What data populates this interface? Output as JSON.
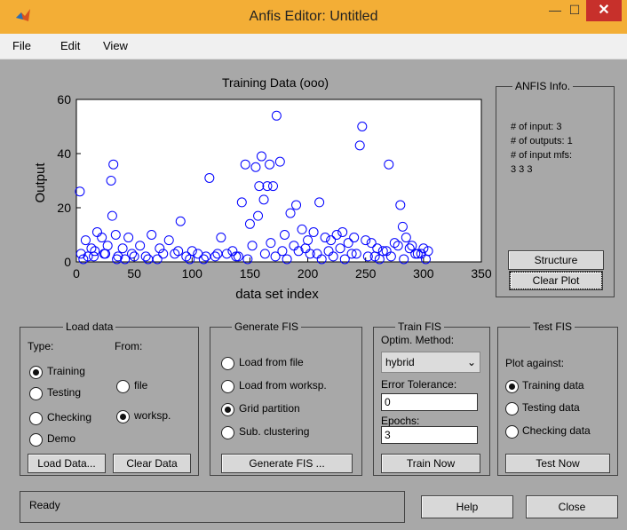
{
  "window": {
    "title": "Anfis Editor: Untitled",
    "controls": {
      "minimize": "—",
      "maximize": "☐",
      "close": "✕"
    }
  },
  "menu": [
    "File",
    "Edit",
    "View"
  ],
  "chart_data": {
    "type": "scatter",
    "title": "Training Data (ooo)",
    "xlabel": "data set index",
    "ylabel": "Output",
    "xlim": [
      0,
      350
    ],
    "ylim": [
      0,
      60
    ],
    "xticks": [
      "0",
      "50",
      "100",
      "150",
      "200",
      "250",
      "300",
      "350"
    ],
    "yticks": [
      "0",
      "20",
      "40",
      "60"
    ],
    "marker": "circle-open",
    "color": "#0000ff",
    "x": [
      3,
      8,
      13,
      18,
      22,
      27,
      30,
      31,
      32,
      34,
      40,
      45,
      55,
      65,
      72,
      80,
      90,
      105,
      115,
      125,
      135,
      143,
      146,
      150,
      155,
      157,
      158,
      160,
      162,
      165,
      167,
      170,
      173,
      176,
      180,
      185,
      190,
      195,
      200,
      205,
      210,
      215,
      220,
      225,
      230,
      235,
      240,
      245,
      247,
      250,
      255,
      260,
      265,
      270,
      275,
      280,
      282,
      285,
      290,
      295,
      300,
      304,
      4,
      10,
      16,
      24,
      36,
      42,
      48,
      60,
      70,
      85,
      95,
      100,
      110,
      120,
      130,
      140,
      152,
      168,
      178,
      188,
      198,
      208,
      218,
      228,
      238,
      258,
      268,
      278,
      288,
      298,
      6,
      15,
      25,
      35,
      50,
      62,
      75,
      88,
      98,
      112,
      122,
      138,
      148,
      163,
      172,
      182,
      192,
      202,
      212,
      222,
      232,
      242,
      252,
      262,
      272,
      283,
      293,
      302
    ],
    "y": [
      26,
      8,
      5,
      11,
      9,
      6,
      30,
      17,
      36,
      10,
      5,
      9,
      6,
      10,
      5,
      8,
      15,
      3,
      31,
      9,
      4,
      22,
      36,
      14,
      35,
      17,
      28,
      39,
      23,
      28,
      36,
      28,
      54,
      37,
      10,
      18,
      21,
      12,
      8,
      11,
      22,
      9,
      8,
      10,
      11,
      7,
      9,
      43,
      50,
      8,
      7,
      5,
      4,
      36,
      7,
      21,
      13,
      9,
      6,
      3,
      5,
      4,
      3,
      2,
      4,
      3,
      2,
      1,
      3,
      2,
      1,
      3,
      2,
      4,
      1,
      2,
      3,
      2,
      6,
      7,
      4,
      6,
      5,
      3,
      4,
      5,
      3,
      2,
      4,
      6,
      5,
      3,
      1,
      2,
      3,
      1,
      2,
      1,
      3,
      4,
      1,
      2,
      3,
      2,
      1,
      3,
      2,
      1,
      4,
      3,
      1,
      2,
      1,
      3,
      2,
      1,
      2,
      1,
      3,
      1
    ],
    "grid": false
  },
  "anfis_info": {
    "title": "ANFIS Info.",
    "lines": [
      "# of input: 3",
      "# of outputs: 1",
      "# of input mfs:",
      "3 3 3"
    ],
    "structure_button": "Structure",
    "clear_plot_button": "Clear Plot"
  },
  "load_data": {
    "title": "Load data",
    "type_label": "Type:",
    "from_label": "From:",
    "types": [
      {
        "label": "Training",
        "selected": true
      },
      {
        "label": "Testing",
        "selected": false
      },
      {
        "label": "Checking",
        "selected": false
      },
      {
        "label": "Demo",
        "selected": false
      }
    ],
    "sources": [
      {
        "label": "file",
        "selected": false
      },
      {
        "label": "worksp.",
        "selected": true
      }
    ],
    "load_button": "Load Data...",
    "clear_button": "Clear Data"
  },
  "generate_fis": {
    "title": "Generate FIS",
    "options": [
      {
        "label": "Load from file",
        "selected": false
      },
      {
        "label": "Load from worksp.",
        "selected": false
      },
      {
        "label": "Grid partition",
        "selected": true
      },
      {
        "label": "Sub. clustering",
        "selected": false
      }
    ],
    "button": "Generate FIS ..."
  },
  "train_fis": {
    "title": "Train FIS",
    "optim_label": "Optim. Method:",
    "optim_value": "hybrid",
    "error_label": "Error Tolerance:",
    "error_value": "0",
    "epochs_label": "Epochs:",
    "epochs_value": "3",
    "button": "Train Now"
  },
  "test_fis": {
    "title": "Test FIS",
    "plot_against_label": "Plot against:",
    "options": [
      {
        "label": "Training data",
        "selected": true
      },
      {
        "label": "Testing data",
        "selected": false
      },
      {
        "label": "Checking data",
        "selected": false
      }
    ],
    "button": "Test Now"
  },
  "status": {
    "text": "Ready"
  },
  "bottom_buttons": {
    "help": "Help",
    "close": "Close"
  }
}
